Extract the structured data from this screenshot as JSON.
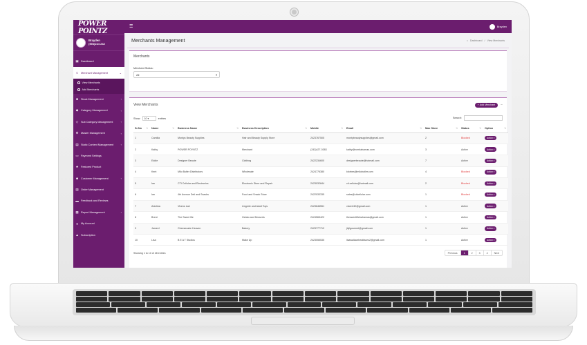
{
  "brand": {
    "logo_text": "POWER POINTZ"
  },
  "user": {
    "name": "Brayden",
    "phone": "(593)224 242"
  },
  "topbar": {
    "menu_icon": "hamburger-icon",
    "user_name": "Brayden"
  },
  "sidebar": {
    "items": [
      {
        "label": "Dashboard",
        "icon": "dashboard-icon",
        "chevron": false
      },
      {
        "label": "Merchant Management",
        "icon": "users-icon",
        "chevron": true,
        "active": true
      },
      {
        "label": "Stock Management",
        "icon": "box-icon",
        "chevron": true
      },
      {
        "label": "Category Management",
        "icon": "tag-icon",
        "chevron": true
      },
      {
        "label": "Sub Category Management",
        "icon": "tags-icon",
        "chevron": true
      },
      {
        "label": "Master Management",
        "icon": "gear-icon",
        "chevron": true
      },
      {
        "label": "Static Content Management",
        "icon": "file-icon",
        "chevron": true
      },
      {
        "label": "Payment Settings",
        "icon": "card-icon",
        "chevron": false
      },
      {
        "label": "Featured Product",
        "icon": "star-icon",
        "chevron": false
      },
      {
        "label": "Customer Management",
        "icon": "user-icon",
        "chevron": true
      },
      {
        "label": "Order Management",
        "icon": "cart-icon",
        "chevron": false
      },
      {
        "label": "Feedback and Reviews",
        "icon": "comment-icon",
        "chevron": false
      },
      {
        "label": "Report Management",
        "icon": "chart-icon",
        "chevron": true
      },
      {
        "label": "My Account",
        "icon": "account-icon",
        "chevron": false
      },
      {
        "label": "Subscription",
        "icon": "bell-icon",
        "chevron": false
      }
    ],
    "sub_items": [
      {
        "label": "View Merchants"
      },
      {
        "label": "Add Merchants"
      }
    ]
  },
  "page": {
    "title": "Merchants Management",
    "breadcrumb": [
      "Dashboard",
      "View Merchants"
    ]
  },
  "filter": {
    "title": "Merchants",
    "status_label": "Merchant Status:",
    "status_value": "All"
  },
  "list": {
    "title": "View Merchants",
    "add_label": "Add Merchant",
    "show_label": "Show",
    "entries_value": "10",
    "entries_label": "entries",
    "search_label": "Search:",
    "columns": [
      "Sr.No",
      "Name",
      "Business Name",
      "Business Description",
      "Mobile",
      "Email",
      "Max Store",
      "Status",
      "Option"
    ],
    "rows": [
      [
        "1",
        "Camilia",
        "Montys Beauty Supplies",
        "Hair and Beauty Supply Store",
        "2423767505",
        "montybeautysupplies@gmail.com",
        "2",
        "Blocked",
        "Action"
      ],
      [
        "2",
        "Kathy",
        "POWER POYNTZ",
        "Merchant",
        "(242)427-0383",
        "kathy@rcmbahamas.com",
        "3",
        "Active",
        "Action"
      ],
      [
        "3",
        "Eddie",
        "Designer Beaute",
        "Clothing",
        "2422234600",
        "designerbeaute@hotmail.com",
        "7",
        "Active",
        "Action"
      ],
      [
        "4",
        "Kent",
        "Milo Butler Distributors",
        "Wholesale",
        "2424776380",
        "kforbes@milobutler.com",
        "4",
        "Blocked",
        "Action"
      ],
      [
        "5",
        "Ian",
        "CTI Cellular and Electronics",
        "Electronic Store and Repair",
        "2423032844",
        "cti.cellular@hotmail.com",
        "2",
        "Blocked",
        "Action"
      ],
      [
        "6",
        "Ian",
        "4th Avenue Deli and Snacks",
        "Food and Snack Store",
        "2422033335",
        "sales@cticellular.com",
        "1",
        "Blocked",
        "Action"
      ],
      [
        "7",
        "Anishka",
        "Vixens Lair",
        "Lingerie and Adult Toys",
        "2423646551",
        "vixen242@gmail.com",
        "1",
        "Active",
        "Action"
      ],
      [
        "8",
        "Brent",
        "The Sweet life",
        "Gelato and Desserts",
        "2424565422",
        "thesweetlifebahamas@gmail.com",
        "1",
        "Active",
        "Action"
      ],
      [
        "9",
        "Jameel",
        "Cheesecake Heaven",
        "Bakery",
        "2423777712",
        "jlzjlgourmet@gmail.com",
        "1",
        "Active",
        "Action"
      ],
      [
        "10",
        "Lisa",
        "B E A T Studios",
        "Make Up",
        "2423055535",
        "lisawallacebeatfaces2@gmail.com",
        "1",
        "Active",
        "Action"
      ]
    ],
    "footer_text": "Showing 1 to 10 of 28 entries",
    "pagination": [
      "Previous",
      "1",
      "2",
      "3",
      "4",
      "Next"
    ]
  },
  "colors": {
    "brand": "#6b1d6e",
    "blocked": "#e03a3a"
  }
}
